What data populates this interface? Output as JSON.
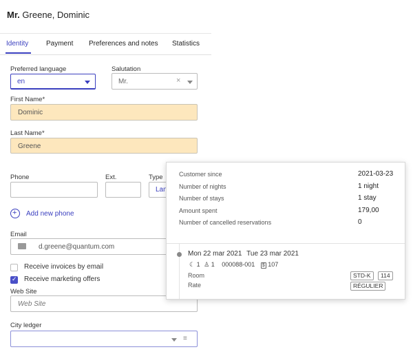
{
  "header": {
    "salutation": "Mr.",
    "name": "Greene, Dominic"
  },
  "tabs": [
    "Identity",
    "Payment",
    "Preferences and notes",
    "Statistics"
  ],
  "form": {
    "preferred_language_label": "Preferred language",
    "preferred_language_value": "en",
    "salutation_label": "Salutation",
    "salutation_value": "Mr.",
    "first_name_label": "First Name",
    "first_name_value": "Dominic",
    "last_name_label": "Last Name",
    "last_name_value": "Greene",
    "required_mark": "*",
    "phone_label": "Phone",
    "ext_label": "Ext.",
    "type_label": "Type",
    "type_value": "Lan",
    "add_phone": "Add new phone",
    "email_label": "Email",
    "email_value": "d.greene@quantum.com",
    "receive_invoices": "Receive invoices by email",
    "receive_invoices_checked": false,
    "receive_marketing": "Receive marketing offers",
    "receive_marketing_checked": true,
    "website_label": "Web Site",
    "website_placeholder": "Web Site",
    "city_ledger_label": "City ledger"
  },
  "stats_popup": {
    "rows": [
      {
        "label": "Customer since",
        "value": "2021-03-23"
      },
      {
        "label": "Number of nights",
        "value": "1 night"
      },
      {
        "label": "Number of stays",
        "value": "1 stay"
      },
      {
        "label": "Amount spent",
        "value": "179,00"
      },
      {
        "label": "Number of cancelled reservations",
        "value": "0"
      }
    ],
    "stay": {
      "arrival_day": "Mon",
      "arrival_date": "22 mar 2021",
      "departure_day": "Tue",
      "departure_date": "23 mar 2021",
      "nights": "1",
      "guests": "1",
      "reservation_number": "000088-001",
      "amount": "107",
      "room_label": "Room",
      "room_type": "STD-K",
      "room_number": "114",
      "rate_label": "Rate",
      "rate_code": "RÉGULIER"
    }
  },
  "colors": {
    "accent": "#3a3fbf",
    "required_field_bg": "#fde7bd"
  }
}
